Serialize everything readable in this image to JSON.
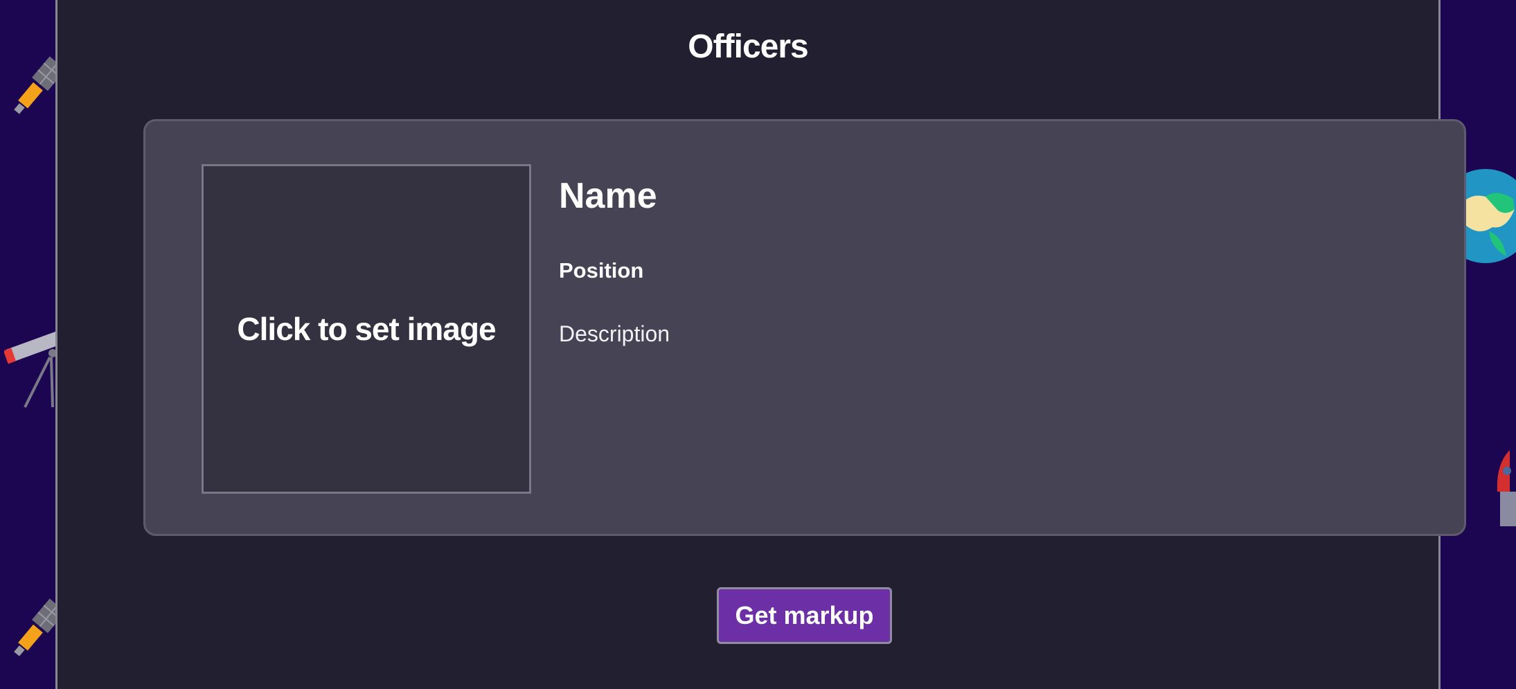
{
  "page": {
    "title": "Officers",
    "colors": {
      "page_background": "#1c0652",
      "panel_background": "#222030",
      "card_background": "#464454",
      "image_box_background": "#343240",
      "button_background": "#6c2fa5"
    }
  },
  "officer_card": {
    "image_placeholder": "Click to set image",
    "name": "Name",
    "position": "Position",
    "description": "Description"
  },
  "actions": {
    "get_markup_label": "Get markup"
  },
  "decorations": [
    "satellite-icon",
    "telescope-icon",
    "satellite-icon",
    "earth-globe-icon",
    "rocket-icon"
  ]
}
